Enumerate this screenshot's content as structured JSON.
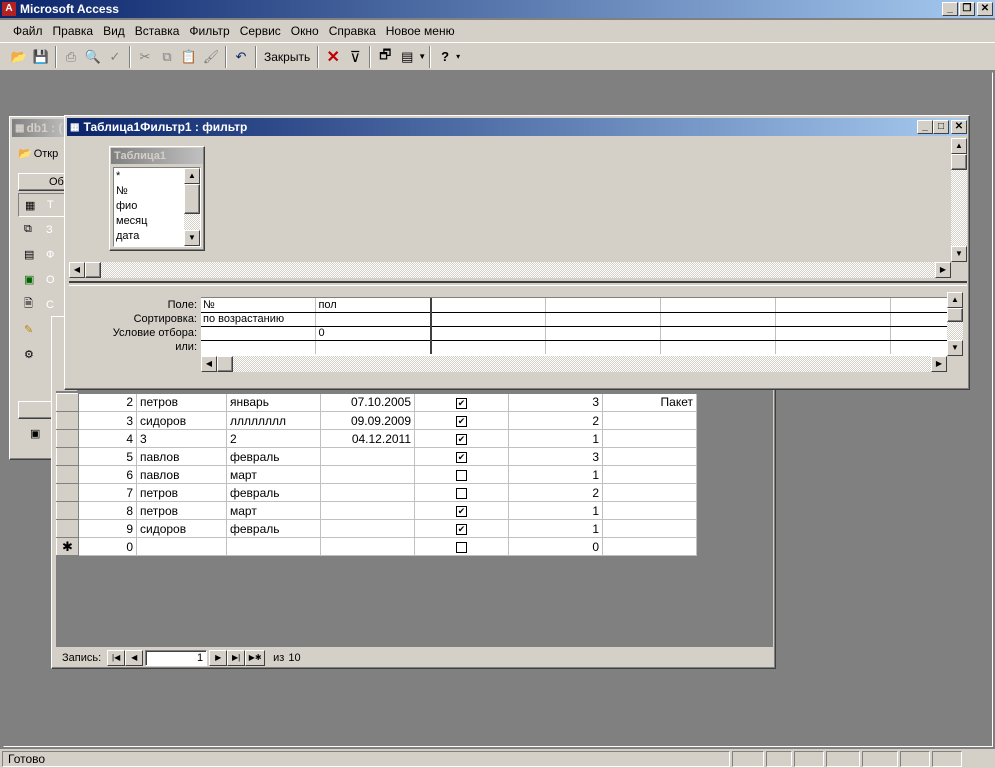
{
  "app": {
    "title": "Microsoft Access"
  },
  "menu": [
    "Файл",
    "Правка",
    "Вид",
    "Вставка",
    "Фильтр",
    "Сервис",
    "Окно",
    "Справка",
    "Новое меню"
  ],
  "toolbar": {
    "close_label": "Закрыть"
  },
  "db_window": {
    "title": "db1 : (",
    "open_label": "Откр",
    "objects_label": "Об",
    "items": [
      "Т",
      "З",
      "Ф",
      "О",
      "С",
      "М",
      "М"
    ]
  },
  "filter_window": {
    "title": "Таблица1Фильтр1 : фильтр",
    "table_box_title": "Таблица1",
    "fields": [
      "*",
      "№",
      "фио",
      "месяц",
      "дата"
    ],
    "row_labels": [
      "Поле:",
      "Сортировка:",
      "Условие отбора:",
      "или:"
    ],
    "grid": [
      [
        "№",
        "пол",
        "",
        "",
        "",
        "",
        ""
      ],
      [
        "по возрастанию",
        "",
        "",
        "",
        "",
        "",
        ""
      ],
      [
        "",
        "0",
        "",
        "",
        "",
        "",
        ""
      ],
      [
        "",
        "",
        "",
        "",
        "",
        "",
        ""
      ]
    ]
  },
  "datasheet": {
    "rows": [
      {
        "id": "2",
        "name": "петров",
        "month": "январь",
        "date": "07.10.2005",
        "checked": true,
        "num": "3",
        "extra": "Пакет"
      },
      {
        "id": "3",
        "name": "сидоров",
        "month": "лллллллл",
        "date": "09.09.2009",
        "checked": true,
        "num": "2",
        "extra": ""
      },
      {
        "id": "4",
        "name": "3",
        "month": "2",
        "date": "04.12.2011",
        "checked": true,
        "num": "1",
        "extra": ""
      },
      {
        "id": "5",
        "name": "павлов",
        "month": "февраль",
        "date": "",
        "checked": true,
        "num": "3",
        "extra": ""
      },
      {
        "id": "6",
        "name": "павлов",
        "month": "март",
        "date": "",
        "checked": false,
        "num": "1",
        "extra": ""
      },
      {
        "id": "7",
        "name": "петров",
        "month": "февраль",
        "date": "",
        "checked": false,
        "num": "2",
        "extra": ""
      },
      {
        "id": "8",
        "name": "петров",
        "month": "март",
        "date": "",
        "checked": true,
        "num": "1",
        "extra": ""
      },
      {
        "id": "9",
        "name": "сидоров",
        "month": "февраль",
        "date": "",
        "checked": true,
        "num": "1",
        "extra": ""
      }
    ],
    "new_row": {
      "marker": "✱",
      "id": "0",
      "num": "0"
    },
    "nav": {
      "label": "Запись:",
      "current": "1",
      "of_label": "из",
      "total": "10"
    }
  },
  "status": {
    "text": "Готово"
  }
}
